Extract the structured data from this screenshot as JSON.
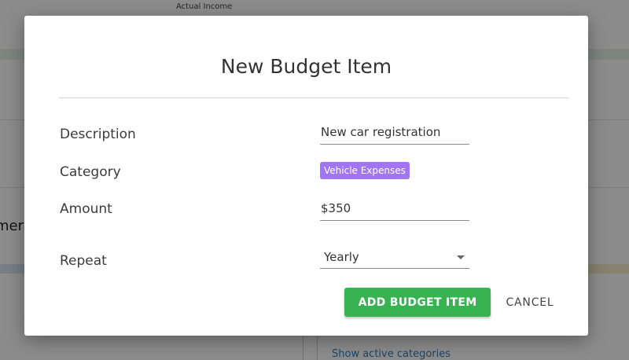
{
  "background": {
    "header_label": "Actual Income",
    "side_text": "mer",
    "link_text": "Show active categories"
  },
  "dialog": {
    "title": "New Budget Item",
    "fields": {
      "description": {
        "label": "Description",
        "value": "New car registration"
      },
      "category": {
        "label": "Category",
        "value": "Vehicle Expenses",
        "chip_color": "#a276f2"
      },
      "amount": {
        "label": "Amount",
        "value": "$350"
      },
      "repeat": {
        "label": "Repeat",
        "value": "Yearly"
      }
    },
    "actions": {
      "primary_label": "ADD BUDGET ITEM",
      "primary_color": "#37b451",
      "cancel_label": "CANCEL"
    }
  }
}
